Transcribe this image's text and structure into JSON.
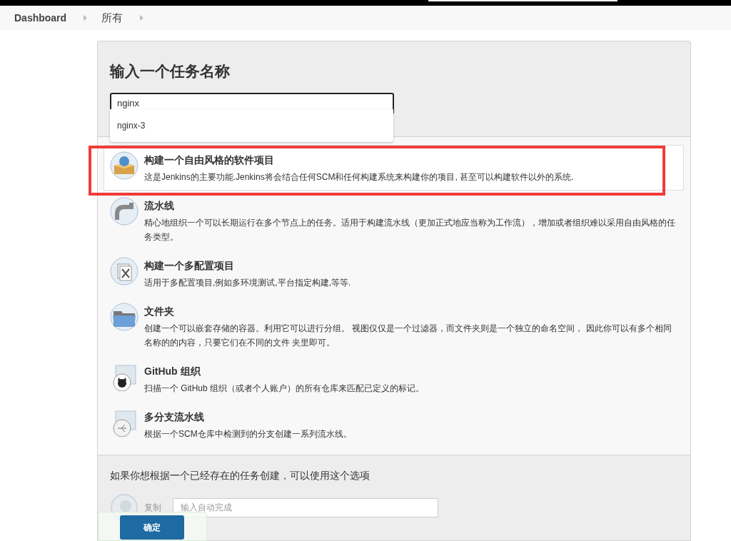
{
  "breadcrumbs": [
    {
      "label": "Dashboard"
    },
    {
      "label": "所有"
    }
  ],
  "form": {
    "title": "输入一个任务名称",
    "name_value": "nginx",
    "suggestions": [
      "nginx-3"
    ]
  },
  "item_types": [
    {
      "kind": "freestyle",
      "title": "构建一个自由风格的软件项目",
      "description": "这是Jenkins的主要功能.Jenkins将会结合任何SCM和任何构建系统来构建你的项目, 甚至可以构建软件以外的系统.",
      "selected": true
    },
    {
      "kind": "pipeline",
      "title": "流水线",
      "description": "精心地组织一个可以长期运行在多个节点上的任务。适用于构建流水线（更加正式地应当称为工作流），增加或者组织难以采用自由风格的任务类型。",
      "selected": false
    },
    {
      "kind": "matrix",
      "title": "构建一个多配置项目",
      "description": "适用于多配置项目,例如多环境测试,平台指定构建,等等.",
      "selected": false
    },
    {
      "kind": "folder",
      "title": "文件夹",
      "description": "创建一个可以嵌套存储的容器。利用它可以进行分组。 视图仅仅是一个过滤器，而文件夹则是一个独立的命名空间， 因此你可以有多个相同名称的的内容，只要它们在不同的文件 夹里即可。",
      "selected": false
    },
    {
      "kind": "github",
      "title": "GitHub 组织",
      "description": "扫描一个 GitHub 组织（或者个人账户）的所有仓库来匹配已定义的标记。",
      "selected": false
    },
    {
      "kind": "multibranch",
      "title": "多分支流水线",
      "description": "根据一个SCM仓库中检测到的分支创建一系列流水线。",
      "selected": false
    }
  ],
  "copy": {
    "hint": "如果你想根据一个已经存在的任务创建，可以使用这个选项",
    "label": "复制",
    "placeholder": "输入自动完成",
    "disabled": true
  },
  "ok_button": "确定"
}
